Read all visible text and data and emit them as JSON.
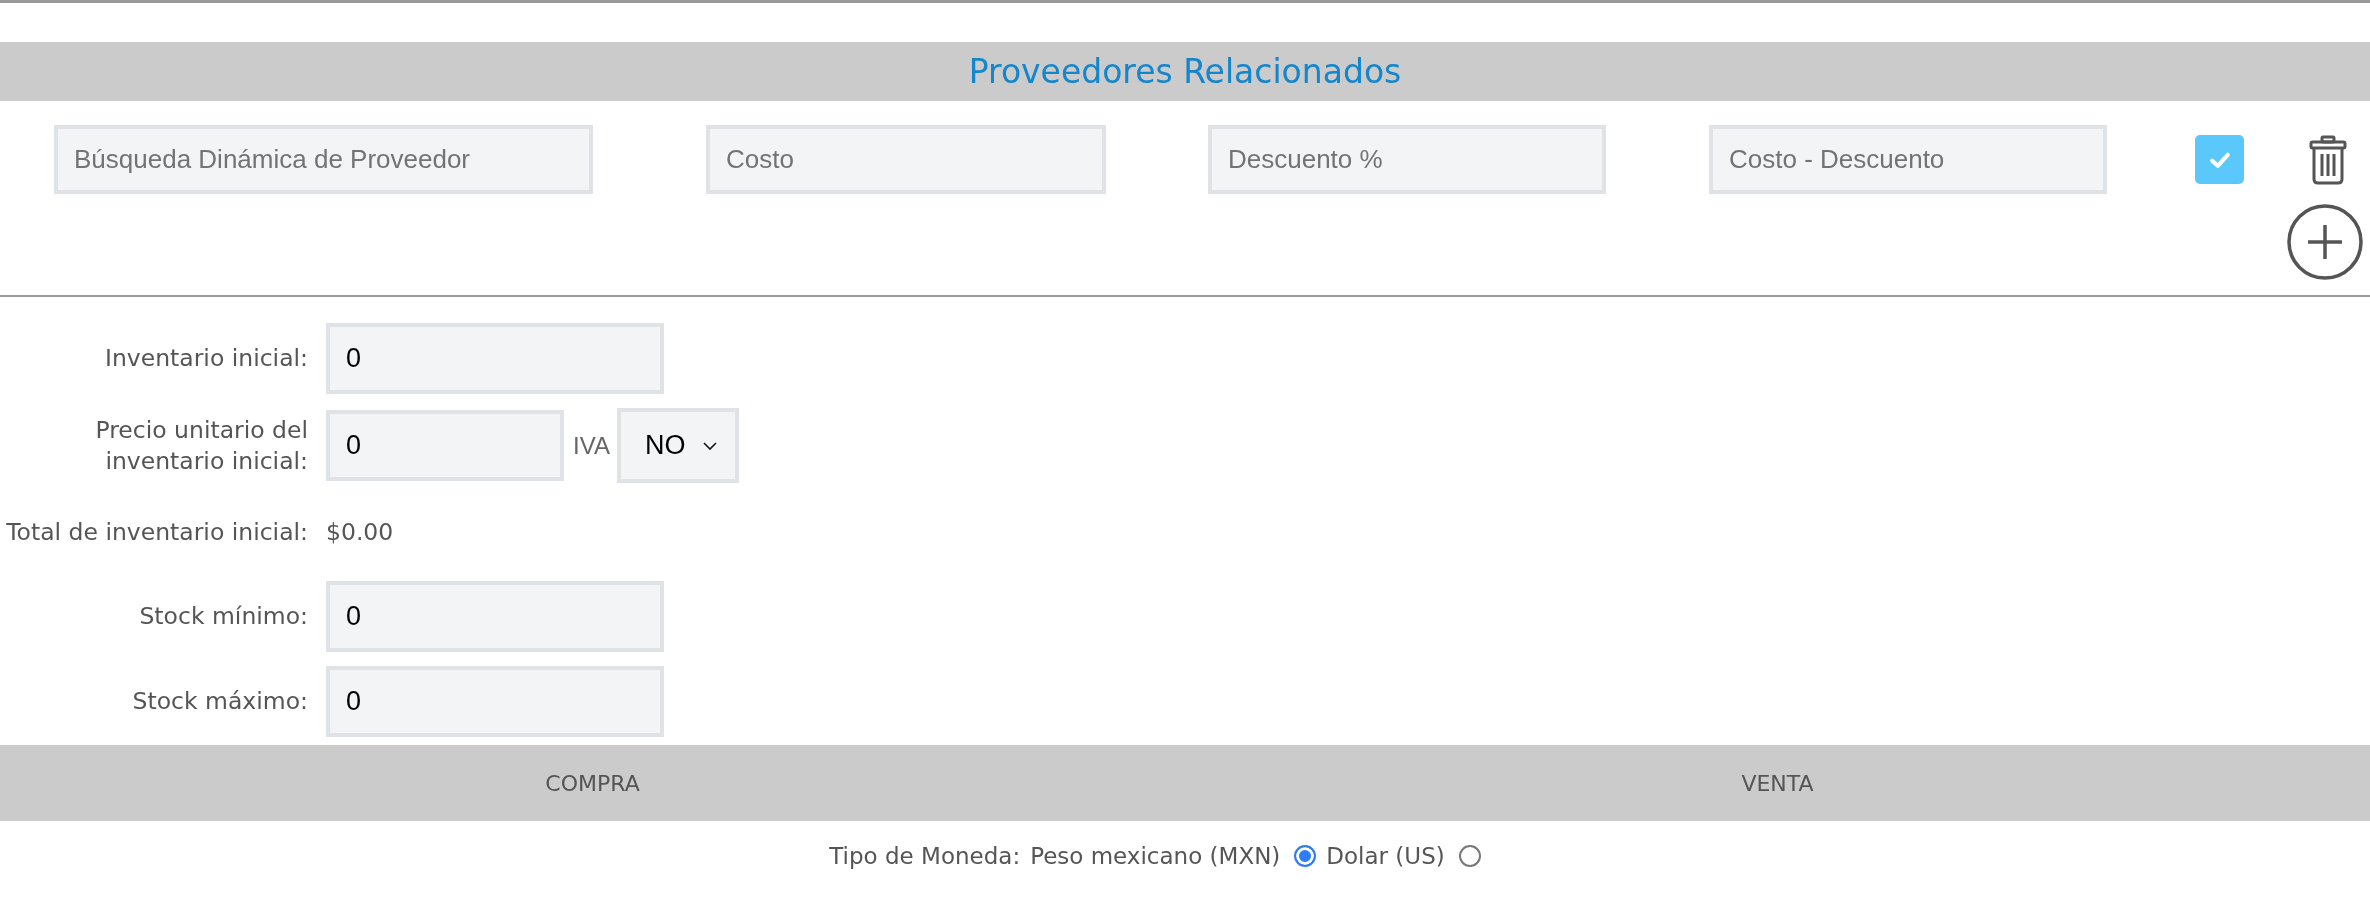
{
  "header": {
    "title": "Proveedores Relacionados"
  },
  "supplier_row": {
    "fields": [
      {
        "placeholder": "Búsqueda Dinámica de Proveedor"
      },
      {
        "placeholder": "Costo"
      },
      {
        "placeholder": "Descuento %"
      },
      {
        "placeholder": "Costo - Descuento"
      }
    ],
    "checked": true
  },
  "form": {
    "rows": [
      {
        "kind": "input",
        "label": "Inventario inicial:",
        "value": "0"
      },
      {
        "kind": "input_select",
        "label": "Precio unitario del inventario inicial:",
        "value": "0",
        "select_label": "IVA",
        "select_value": "NO"
      },
      {
        "kind": "text",
        "label": "Total de inventario inicial:",
        "value": "$0.00"
      },
      {
        "kind": "input",
        "label": "Stock mínimo:",
        "value": "0"
      },
      {
        "kind": "input",
        "label": "Stock máximo:",
        "value": "0"
      }
    ]
  },
  "sections": [
    {
      "label": "COMPRA"
    },
    {
      "label": "VENTA"
    }
  ],
  "currency": {
    "label": "Tipo de Moneda:",
    "options": [
      {
        "label": "Peso mexicano (MXN)",
        "selected": true
      },
      {
        "label": "Dolar (US)",
        "selected": false
      }
    ]
  }
}
